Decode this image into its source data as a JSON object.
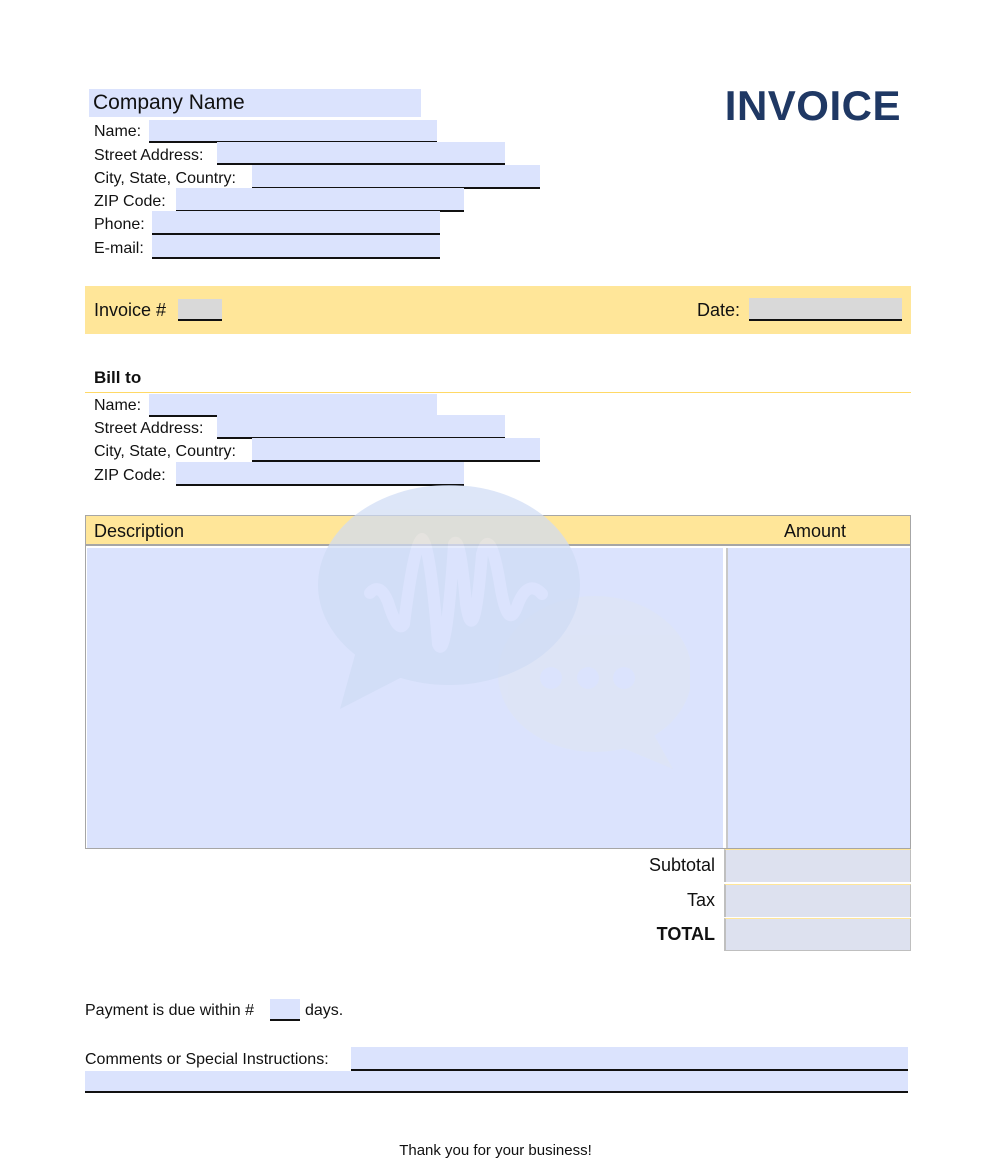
{
  "header": {
    "company_name": "Company Name",
    "title": "INVOICE",
    "title_color": "#1f3864"
  },
  "company_fields": [
    {
      "label": "Name:",
      "value": ""
    },
    {
      "label": "Street Address:",
      "value": ""
    },
    {
      "label": "City, State, Country:",
      "value": ""
    },
    {
      "label": "ZIP Code:",
      "value": ""
    },
    {
      "label": "Phone:",
      "value": ""
    },
    {
      "label": "E-mail:",
      "value": ""
    }
  ],
  "invoice_bar": {
    "invoice_label": "Invoice #",
    "invoice_value": "",
    "date_label": "Date:",
    "date_value": "",
    "bar_color": "#ffe699"
  },
  "bill_to": {
    "heading": "Bill to",
    "fields": [
      {
        "label": "Name:",
        "value": ""
      },
      {
        "label": "Street Address:",
        "value": ""
      },
      {
        "label": "City, State, Country:",
        "value": ""
      },
      {
        "label": "ZIP Code:",
        "value": ""
      }
    ]
  },
  "items_table": {
    "columns": [
      "Description",
      "Amount"
    ],
    "description_value": "",
    "amount_value": ""
  },
  "totals": [
    {
      "label": "Subtotal",
      "value": ""
    },
    {
      "label": "Tax",
      "value": ""
    },
    {
      "label": "TOTAL",
      "value": ""
    }
  ],
  "payment": {
    "prefix": "Payment is due within #",
    "days_value": "",
    "suffix": "days."
  },
  "comments": {
    "label": "Comments or Special Instructions:",
    "value": ""
  },
  "footer": {
    "thank_you": "Thank you for your business!"
  },
  "watermark": {
    "icon": "chat-bubbles-soundwave-icon"
  },
  "colors": {
    "field_fill": "#dbe3fd",
    "total_fill": "#dde1ef",
    "accent_yellow": "#ffe699"
  }
}
